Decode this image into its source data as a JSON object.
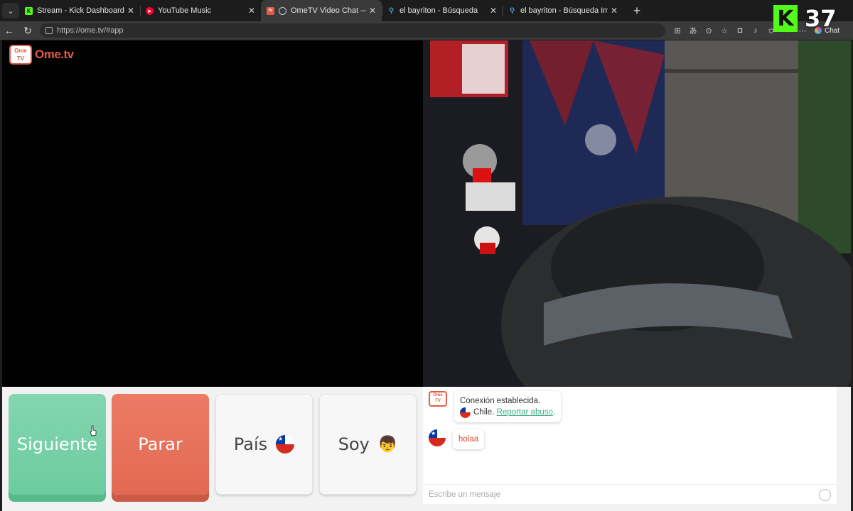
{
  "browser": {
    "tabs": [
      {
        "label": "Stream - Kick Dashboard",
        "favicon": "kick-favicon",
        "color": "#53fc18",
        "active": false
      },
      {
        "label": "YouTube Music",
        "favicon": "youtube-music-favicon",
        "color": "#ff0033",
        "active": false
      },
      {
        "label": "OmeTV Video Chat — Omegle",
        "favicon": "ometv-favicon",
        "color": "#e25b45",
        "active": true
      },
      {
        "label": "el bayriton - Búsqueda",
        "favicon": "search-favicon",
        "color": "#4aa3df",
        "active": false
      },
      {
        "label": "el bayriton - Búsqueda Imágenes",
        "favicon": "search-favicon",
        "color": "#4aa3df",
        "active": false
      }
    ],
    "url": "https://ome.tv/#app",
    "chat_button_label": "Chat"
  },
  "overlay": {
    "kick_logo": "K",
    "viewer_count": "37"
  },
  "app": {
    "logo_text": "Ome.tv",
    "logo_box": "Ome TV"
  },
  "controls": {
    "next_label": "Siguiente",
    "stop_label": "Parar",
    "country_label": "País",
    "gender_label": "Soy"
  },
  "chat": {
    "system_line1": "Conexión establecida.",
    "system_country": "Chile.",
    "report_link": "Reportar abuso",
    "report_suffix": ".",
    "user_message": "holaa",
    "input_placeholder": "Escribe un mensaje"
  },
  "colors": {
    "brand": "#e25b45",
    "next": "#6ccb9f",
    "stop": "#e26a52",
    "link": "#3fae88"
  }
}
